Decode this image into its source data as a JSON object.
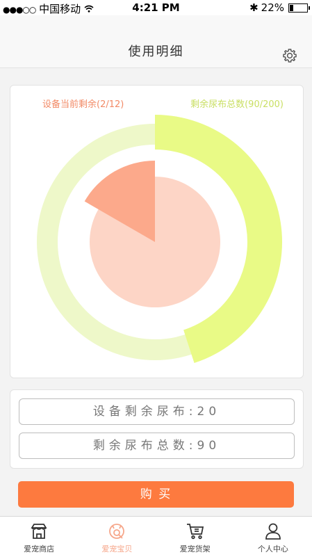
{
  "status_bar": {
    "signal_dots": "●●●○○",
    "carrier": "中国移动",
    "time": "4:21 PM",
    "bluetooth": "✱",
    "battery_text": "22%",
    "battery_level": 0.22
  },
  "header": {
    "title": "使用明细"
  },
  "chart": {
    "device_label": "设备当前剩余(2/12)",
    "total_label": "剩余尿布总数(90/200)",
    "colors": {
      "outer_track": "#eef8c9",
      "outer_fill": "#e9fa86",
      "inner_base": "#fdd5c6",
      "inner_fill": "#fca98b",
      "device_text": "#f28a66",
      "total_text": "#c9df62"
    }
  },
  "chart_data": [
    {
      "type": "pie",
      "title": "设备当前剩余(2/12)",
      "values": [
        2,
        10
      ],
      "max": 12
    },
    {
      "type": "pie",
      "title": "剩余尿布总数(90/200)",
      "values": [
        90,
        110
      ],
      "max": 200
    }
  ],
  "info": {
    "device_remaining": "设备剩余尿布:20",
    "total_remaining": "剩余尿布总数:90"
  },
  "buy_button": {
    "label": "购  买",
    "color": "#fd7a3f"
  },
  "tabs": [
    {
      "label": "爱宠商店",
      "icon": "store-icon",
      "active": false
    },
    {
      "label": "爱宠宝贝",
      "icon": "pet-icon",
      "active": true
    },
    {
      "label": "爱宠货架",
      "icon": "cart-icon",
      "active": false
    },
    {
      "label": "个人中心",
      "icon": "user-icon",
      "active": false
    }
  ]
}
